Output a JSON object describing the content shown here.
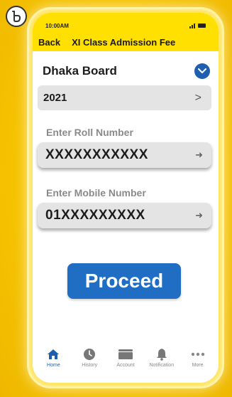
{
  "status_bar": {
    "time": "10:00AM"
  },
  "nav": {
    "back_label": "Back",
    "title": "XI Class Admission Fee"
  },
  "board": {
    "label": "Dhaka Board"
  },
  "year": {
    "value": "2021"
  },
  "roll": {
    "label": "Enter Roll Number",
    "value": "XXXXXXXXXXX"
  },
  "mobile": {
    "label": "Enter Mobile Number",
    "value": "01XXXXXXXXX"
  },
  "proceed": {
    "label": "Proceed"
  },
  "tabs": [
    {
      "label": "Home",
      "icon": "home-icon"
    },
    {
      "label": "History",
      "icon": "clock-icon"
    },
    {
      "label": "Account",
      "icon": "wallet-icon"
    },
    {
      "label": "Notification",
      "icon": "bell-icon"
    },
    {
      "label": "More",
      "icon": "more-icon"
    }
  ],
  "colors": {
    "background": "#f7c400",
    "header": "#ffe000",
    "accent_blue": "#1f6ec4",
    "field_gray": "#e4e4e4"
  }
}
